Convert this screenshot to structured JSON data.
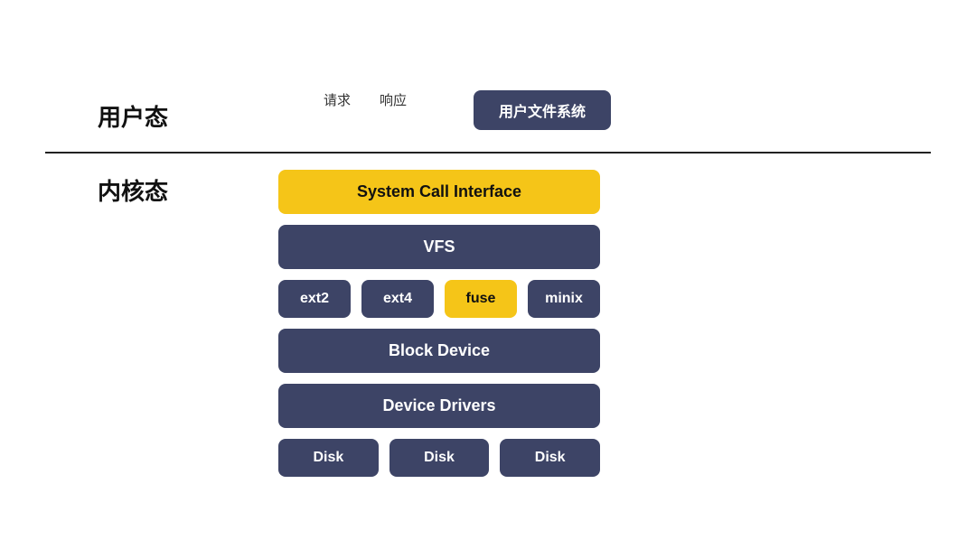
{
  "labels": {
    "user_zone": "用户态",
    "kernel_zone": "内核态",
    "request": "请求",
    "response": "响应",
    "user_fs": "用户文件系统",
    "system_call_interface": "System Call Interface",
    "vfs": "VFS",
    "ext2": "ext2",
    "ext4": "ext4",
    "fuse": "fuse",
    "minix": "minix",
    "block_device": "Block Device",
    "device_drivers": "Device Drivers",
    "disk1": "Disk",
    "disk2": "Disk",
    "disk3": "Disk"
  },
  "colors": {
    "yellow": "#f5c518",
    "dark": "#3d4466",
    "white": "#ffffff",
    "black": "#111111"
  }
}
